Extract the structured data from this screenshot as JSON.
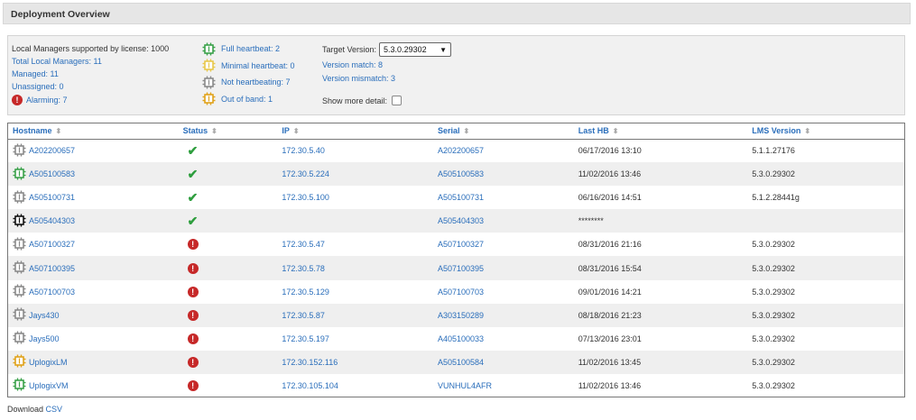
{
  "title": "Deployment Overview",
  "summary": {
    "supported": "Local Managers supported by license: 1000",
    "total": "Total Local Managers: 11",
    "managed": "Managed: 11",
    "unassigned": "Unassigned: 0",
    "alarming": "Alarming: 7",
    "full_hb": "Full heartbeat: 2",
    "min_hb": "Minimal heartbeat: 0",
    "not_hb": "Not heartbeating: 7",
    "oob": "Out of band: 1",
    "target_label": "Target Version:",
    "target_value": "5.3.0.29302",
    "version_match": "Version match: 8",
    "version_mismatch": "Version mismatch: 3",
    "show_detail": "Show more detail:"
  },
  "colors": {
    "green": "#3aa14a",
    "yellow": "#e8c84a",
    "gray": "#8a8a8a",
    "orange": "#e0a21a",
    "black": "#111111"
  },
  "table": {
    "headers": {
      "hostname": "Hostname",
      "status": "Status",
      "ip": "IP",
      "serial": "Serial",
      "last_hb": "Last HB",
      "lms": "LMS Version"
    },
    "rows": [
      {
        "hostname": "A202200657",
        "icon": "gray",
        "status": "ok",
        "ip": "172.30.5.40",
        "serial": "A202200657",
        "last_hb": "06/17/2016 13:10",
        "lms": "5.1.1.27176"
      },
      {
        "hostname": "A505100583",
        "icon": "green",
        "status": "ok",
        "ip": "172.30.5.224",
        "serial": "A505100583",
        "last_hb": "11/02/2016 13:46",
        "lms": "5.3.0.29302"
      },
      {
        "hostname": "A505100731",
        "icon": "gray",
        "status": "ok",
        "ip": "172.30.5.100",
        "serial": "A505100731",
        "last_hb": "06/16/2016 14:51",
        "lms": "5.1.2.28441g"
      },
      {
        "hostname": "A505404303",
        "icon": "black",
        "status": "ok",
        "ip": "",
        "serial": "A505404303",
        "last_hb": "********",
        "lms": ""
      },
      {
        "hostname": "A507100327",
        "icon": "gray",
        "status": "alarm",
        "ip": "172.30.5.47",
        "serial": "A507100327",
        "last_hb": "08/31/2016 21:16",
        "lms": "5.3.0.29302"
      },
      {
        "hostname": "A507100395",
        "icon": "gray",
        "status": "alarm",
        "ip": "172.30.5.78",
        "serial": "A507100395",
        "last_hb": "08/31/2016 15:54",
        "lms": "5.3.0.29302"
      },
      {
        "hostname": "A507100703",
        "icon": "gray",
        "status": "alarm",
        "ip": "172.30.5.129",
        "serial": "A507100703",
        "last_hb": "09/01/2016 14:21",
        "lms": "5.3.0.29302"
      },
      {
        "hostname": "Jays430",
        "icon": "gray",
        "status": "alarm",
        "ip": "172.30.5.87",
        "serial": "A303150289",
        "last_hb": "08/18/2016 21:23",
        "lms": "5.3.0.29302"
      },
      {
        "hostname": "Jays500",
        "icon": "gray",
        "status": "alarm",
        "ip": "172.30.5.197",
        "serial": "A405100033",
        "last_hb": "07/13/2016 23:01",
        "lms": "5.3.0.29302"
      },
      {
        "hostname": "UplogixLM",
        "icon": "orange",
        "status": "alarm",
        "ip": "172.30.152.116",
        "serial": "A505100584",
        "last_hb": "11/02/2016 13:45",
        "lms": "5.3.0.29302"
      },
      {
        "hostname": "UplogixVM",
        "icon": "green",
        "status": "alarm",
        "ip": "172.30.105.104",
        "serial": "VUNHUL4AFR",
        "last_hb": "11/02/2016 13:46",
        "lms": "5.3.0.29302"
      }
    ]
  },
  "footer": {
    "download": "Download",
    "csv": "CSV"
  }
}
